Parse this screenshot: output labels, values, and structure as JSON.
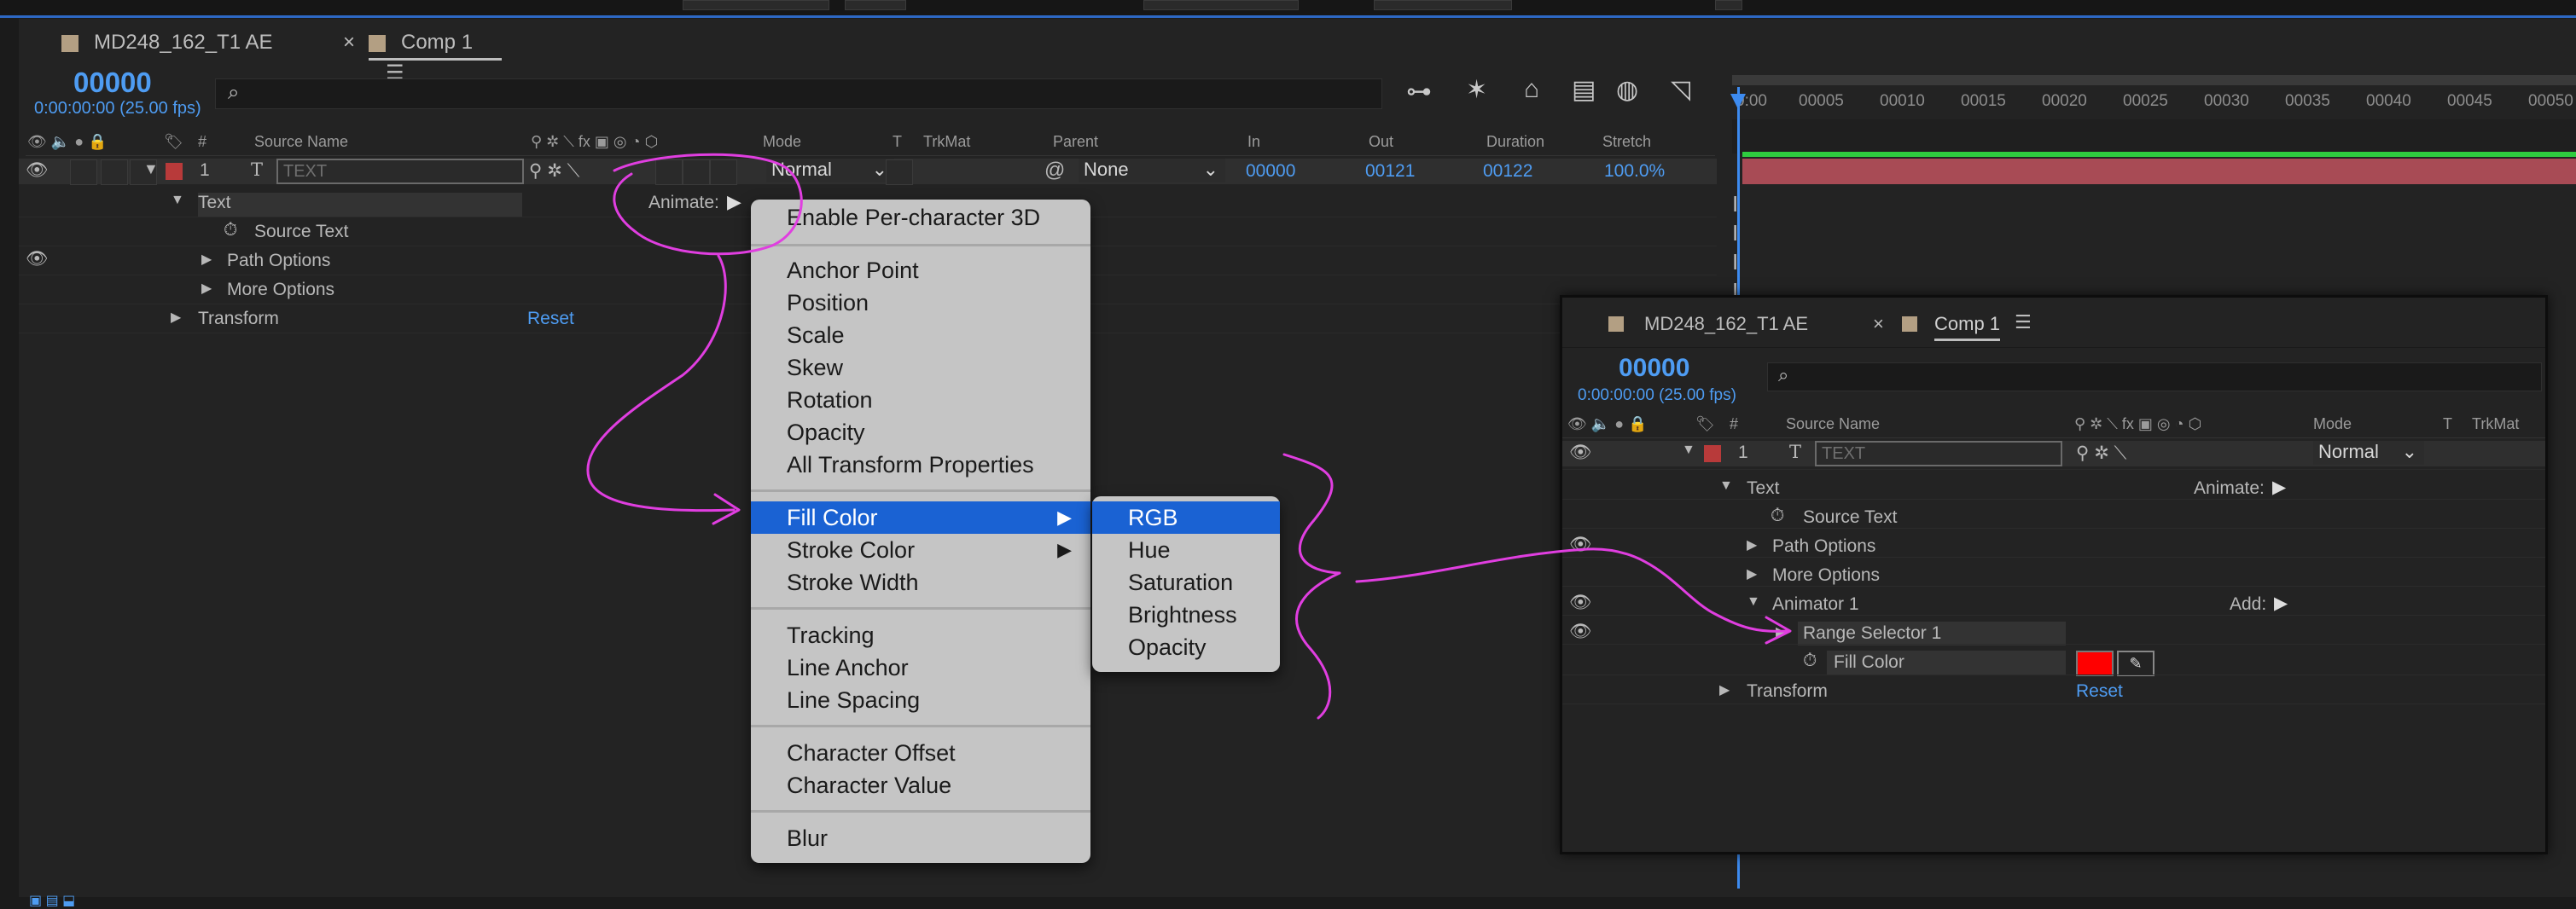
{
  "tabs": {
    "project": "MD248_162_T1 AE",
    "comp": "Comp 1",
    "close_glyph": "×",
    "menu_glyph": "☰"
  },
  "timecode": {
    "value": "00000",
    "sub": "0:00:00:00 (25.00 fps)"
  },
  "headers": {
    "num": "#",
    "source_name": "Source Name",
    "mode": "Mode",
    "t": "T",
    "trkmat": "TrkMat",
    "parent": "Parent",
    "in": "In",
    "out": "Out",
    "duration": "Duration",
    "stretch": "Stretch"
  },
  "layer": {
    "number": "1",
    "type_glyph": "T",
    "name": "TEXT",
    "mode": "Normal",
    "parent": "None",
    "in": "00000",
    "out": "00121",
    "duration": "00122",
    "stretch": "100.0%",
    "color": "#b83a3a"
  },
  "props": {
    "text": "Text",
    "animate": "Animate:",
    "source_text": "Source Text",
    "path_options": "Path Options",
    "more_options": "More Options",
    "transform": "Transform",
    "reset": "Reset"
  },
  "ruler": {
    "ticks": [
      "00005",
      "00010",
      "00015",
      "00020",
      "00025",
      "00030",
      "00035",
      "00040",
      "00045",
      "00050"
    ],
    "start": "0:00"
  },
  "context_menu": {
    "groups": [
      [
        "Enable Per-character 3D"
      ],
      [
        "Anchor Point",
        "Position",
        "Scale",
        "Skew",
        "Rotation",
        "Opacity",
        "All Transform Properties"
      ],
      [
        "Fill Color",
        "Stroke Color",
        "Stroke Width"
      ],
      [
        "Tracking",
        "Line Anchor",
        "Line Spacing"
      ],
      [
        "Character Offset",
        "Character Value"
      ],
      [
        "Blur"
      ]
    ],
    "selected": "Fill Color",
    "submenu": [
      "RGB",
      "Hue",
      "Saturation",
      "Brightness",
      "Opacity"
    ],
    "submenu_selected": "RGB"
  },
  "inset": {
    "project_tab": "MD248_162_T1 AE",
    "comp_tab": "Comp 1",
    "timecode": "00000",
    "timecode_sub": "0:00:00:00 (25.00 fps)",
    "headers": {
      "num": "#",
      "source_name": "Source Name",
      "mode": "Mode",
      "t": "T",
      "trkmat": "TrkMat"
    },
    "layer_number": "1",
    "layer_name": "TEXT",
    "mode": "Normal",
    "text": "Text",
    "animate": "Animate:",
    "source_text": "Source Text",
    "path_options": "Path Options",
    "more_options": "More Options",
    "animator": "Animator 1",
    "add": "Add:",
    "range_selector": "Range Selector 1",
    "fill_color": "Fill Color",
    "transform": "Transform",
    "reset": "Reset",
    "fill_swatch": "#ff0000"
  },
  "annotation_color": "#e03ee0"
}
